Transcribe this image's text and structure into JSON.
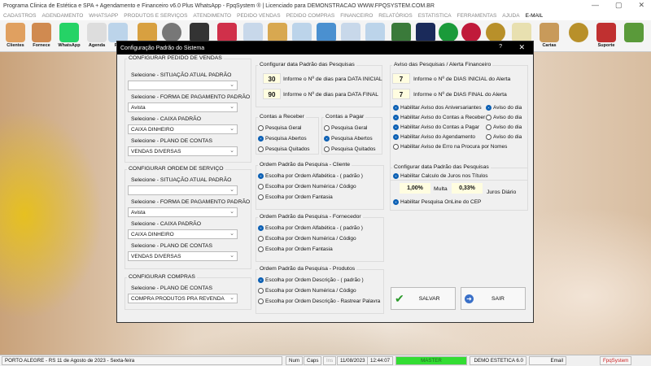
{
  "window": {
    "title": "Programa Clinica de Estética e SPA + Agendamento e Financeiro v6.0 Plus WhatsApp - FpqSystem ® | Licenciado para  DEMONSTRACAO WWW.FPQSYSTEM.COM.BR",
    "minimize": "—",
    "maximize": "▢",
    "close": "✕"
  },
  "menu": [
    "CADASTROS",
    "AGENDAMENTO",
    "WHATSAPP",
    "PRODUTOS E SERVIÇOS",
    "ATENDIMENTO",
    "PEDIDO VENDAS",
    "PEDIDO COMPRAS",
    "FINANCEIRO",
    "RELATÓRIOS",
    "ESTATISTICA",
    "FERRAMENTAS",
    "AJUDA",
    "E-MAIL"
  ],
  "toolbar": {
    "clientes": "Clientes",
    "fornece": "Fornece",
    "whatsapp": "WhatsApp",
    "agenda": "Agenda",
    "rel": "Rel",
    "cartas": "Cartas",
    "suporte": "Suporte"
  },
  "dialog": {
    "title": "Configuração Padrão do Sistema",
    "help": "?",
    "close": "✕",
    "vendas": {
      "title": "CONFIGURAR PEDIDO DE VENDAS",
      "l1": "Selecione - SITUAÇÃO ATUAL PADRÃO",
      "v1": "",
      "l2": "Selecione - FORMA DE PAGAMENTO PADRÃO",
      "v2": "Avista",
      "l3": "Selecione - CAIXA PADRÃO",
      "v3": "CAIXA DINHEIRO",
      "l4": "Selecione - PLANO DE CONTAS",
      "v4": "VENDAS DIVERSAS"
    },
    "os": {
      "title": "CONFIGURAR ORDEM DE SERVIÇO",
      "l1": "Selecione - SITUAÇÃO ATUAL PADRÃO",
      "v1": "",
      "l2": "Selecione - FORMA DE PAGAMENTO PADRÃO",
      "v2": "Avista",
      "l3": "Selecione - CAIXA PADRÃO",
      "v3": "CAIXA DINHEIRO",
      "l4": "Selecione - PLANO DE CONTAS",
      "v4": "VENDAS DIVERSAS"
    },
    "compras": {
      "title": "CONFIGURAR COMPRAS",
      "l1": "Selecione - PLANO DE CONTAS",
      "v1": "COMPRA PRODUTOS PRA REVENDA"
    },
    "datas": {
      "title": "Configurar data Padrão das Pesquisas",
      "ini": "30",
      "ini_label": "Informe o Nº de dias para DATA INICIAL",
      "fim": "90",
      "fim_label": "Informe o Nº de dias para DATA FINAL"
    },
    "receber": {
      "title": "Contas a Receber",
      "opts": [
        "Pesquisa Geral",
        "Pesquisa Abertos",
        "Pesquisa Quitados"
      ]
    },
    "pagar": {
      "title": "Contas a Pagar",
      "opts": [
        "Pesquisa Geral",
        "Pesquisa Abertos",
        "Pesquisa Quitados"
      ]
    },
    "cliente": {
      "title": "Ordem Padrão da Pesquisa - Cliente",
      "opts": [
        "Escolha por Ordem Alfabética - ( padrão )",
        "Escolha por Ordem Numérica / Código",
        "Escolha por Ordem Fantasia"
      ]
    },
    "fornecedor": {
      "title": "Ordem Padrão da Pesquisa - Fornecedor",
      "opts": [
        "Escolha por Ordem Alfabética - ( padrão )",
        "Escolha por Ordem Numérica / Código",
        "Escolha por Ordem Fantasia"
      ]
    },
    "produtos": {
      "title": "Ordem Padrão da Pesquisa - Produtos",
      "opts": [
        "Escolha por Ordem Descrição - ( padrão )",
        "Escolha por Ordem Numérica / Código",
        "Escolha por Ordem Descrição - Rastrear Palavra"
      ]
    },
    "aviso": {
      "title": "Aviso das Pesquisas / Alerta Financeiro",
      "ini": "7",
      "ini_label": "Informe o Nº de DIAS INICIAL do Alerta",
      "fim": "7",
      "fim_label": "Informe o Nº de DIAS FINAL do Alerta",
      "opts": [
        "Habilitar Aviso dos Aniversariantes",
        "Habilitar Aviso do Contas a Receber",
        "Habilitar Aviso do Contas a Pagar",
        "Habilitar Aviso do Agendamento",
        "Habilitar Aviso de Erro na Procura por Nomes"
      ],
      "dia": "Aviso do dia"
    },
    "juros": {
      "title": "Configurar data Padrão das Pesquisas",
      "calc": "Habilitar Calculo de Juros nos Títulos",
      "multa": "1,00%",
      "multa_label": "Multa",
      "juros": "0,33%",
      "juros_label": "Juros Diário",
      "cep": "Habilitar Pesquisa OnLine do CEP"
    },
    "salvar": "SALVAR",
    "sair": "SAIR"
  },
  "status": {
    "location": "PORTO ALEGRE - RS 11 de Agosto de 2023 - Sexta-feira",
    "num": "Num",
    "caps": "Caps",
    "ins": "Ins",
    "date": "11/08/2023",
    "time": "12:44:07",
    "user": "MASTER",
    "db": "DEMO ESTETICA 6.0",
    "email": "Email",
    "brand": "FpqSystem"
  },
  "colors": {
    "accent": "#0a5fb4",
    "master": "#33dd33",
    "brand": "#cc2222"
  }
}
